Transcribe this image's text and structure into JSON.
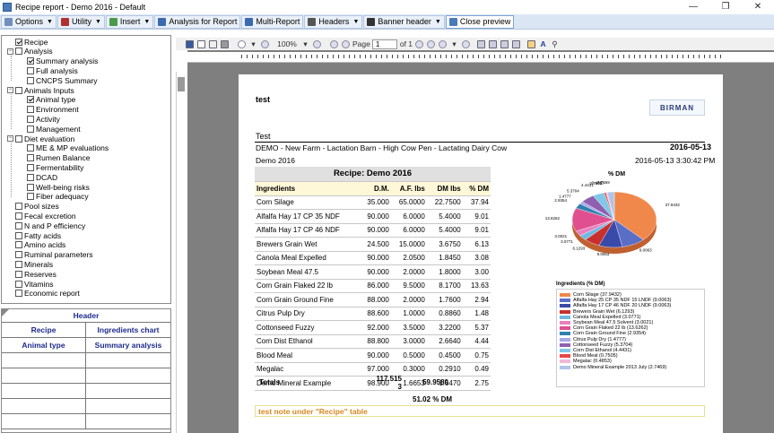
{
  "window": {
    "title": "Recipe report - Demo 2016 - Default"
  },
  "toolbar": [
    {
      "label": "Options",
      "dropdown": true,
      "icon": "gear-icon",
      "color": "#6f8fbf"
    },
    {
      "label": "Utility",
      "dropdown": true,
      "icon": "utility-icon",
      "color": "#b03030"
    },
    {
      "label": "Insert",
      "dropdown": true,
      "icon": "insert-icon",
      "color": "#4a9a4a"
    },
    {
      "label": "Analysis for Report",
      "dropdown": false,
      "icon": "analysis-icon",
      "color": "#3a6ab0"
    },
    {
      "label": "Multi-Report",
      "dropdown": false,
      "icon": "multi-report-icon",
      "color": "#3a6ab0"
    },
    {
      "label": "Headers",
      "dropdown": true,
      "icon": "headers-icon",
      "color": "#555555"
    },
    {
      "label": "Banner header",
      "dropdown": true,
      "icon": "banner-header-icon",
      "color": "#333333"
    },
    {
      "label": "Close preview",
      "dropdown": false,
      "icon": "close-preview-icon",
      "color": "#4a7ab8"
    }
  ],
  "tree": [
    {
      "label": "Recipe",
      "level": 0,
      "checked": true,
      "expander": false
    },
    {
      "label": "Analysis",
      "level": 0,
      "checked": false,
      "expander": true
    },
    {
      "label": "Summary analysis",
      "level": 1,
      "checked": true
    },
    {
      "label": "Full analysis",
      "level": 1,
      "checked": false
    },
    {
      "label": "CNCPS Summary",
      "level": 1,
      "checked": false
    },
    {
      "label": "Animals Inputs",
      "level": 0,
      "checked": false,
      "expander": true
    },
    {
      "label": "Animal type",
      "level": 1,
      "checked": true
    },
    {
      "label": "Environment",
      "level": 1,
      "checked": false
    },
    {
      "label": "Activity",
      "level": 1,
      "checked": false
    },
    {
      "label": "Management",
      "level": 1,
      "checked": false
    },
    {
      "label": "Diet evaluation",
      "level": 0,
      "checked": false,
      "expander": true
    },
    {
      "label": "ME & MP evaluations",
      "level": 1,
      "checked": false
    },
    {
      "label": "Rumen Balance",
      "level": 1,
      "checked": false
    },
    {
      "label": "Fermentability",
      "level": 1,
      "checked": false
    },
    {
      "label": "DCAD",
      "level": 1,
      "checked": false
    },
    {
      "label": "Well-being risks",
      "level": 1,
      "checked": false
    },
    {
      "label": "Fiber adequacy",
      "level": 1,
      "checked": false
    },
    {
      "label": "Pool sizes",
      "level": 0,
      "checked": false
    },
    {
      "label": "Fecal excretion",
      "level": 0,
      "checked": false
    },
    {
      "label": "N and P efficiency",
      "level": 0,
      "checked": false
    },
    {
      "label": "Fatty acids",
      "level": 0,
      "checked": false
    },
    {
      "label": "Amino acids",
      "level": 0,
      "checked": false
    },
    {
      "label": "Ruminal parameters",
      "level": 0,
      "checked": false
    },
    {
      "label": "Minerals",
      "level": 0,
      "checked": false
    },
    {
      "label": "Reserves",
      "level": 0,
      "checked": false
    },
    {
      "label": "Vitamins",
      "level": 0,
      "checked": false
    },
    {
      "label": "Economic report",
      "level": 0,
      "checked": false
    }
  ],
  "header_grid": {
    "title": "Header",
    "rows": [
      [
        "Recipe",
        "Ingredients chart"
      ],
      [
        "Animal type",
        "Summary analysis"
      ]
    ]
  },
  "viewer": {
    "zoom": "100%",
    "page_label": "Page",
    "page": "1",
    "of_label": "of 1"
  },
  "report": {
    "heading": "test",
    "logo_text": "BIRMAN",
    "subtitle": "Test",
    "farm_line": "DEMO - New Farm - Lactation Barn - High Cow Pen - Lactating Dairy Cow",
    "date": "2016-05-13",
    "recipe_name": "Demo 2016",
    "timestamp": "2016-05-13 3:30:42 PM",
    "table_title": "Recipe: Demo 2016",
    "columns": [
      "Ingredients",
      "D.M.",
      "A.F. lbs",
      "DM lbs",
      "% DM"
    ],
    "rows": [
      [
        "Corn Silage",
        "35.000",
        "65.0000",
        "22.7500",
        "37.94"
      ],
      [
        "Alfalfa Hay 17 CP 35 NDF",
        "90.000",
        "6.0000",
        "5.4000",
        "9.01"
      ],
      [
        "Alfalfa Hay 17 CP 46 NDF",
        "90.000",
        "6.0000",
        "5.4000",
        "9.01"
      ],
      [
        "Brewers Grain Wet",
        "24.500",
        "15.0000",
        "3.6750",
        "6.13"
      ],
      [
        "Canola Meal Expelled",
        "90.000",
        "2.0500",
        "1.8450",
        "3.08"
      ],
      [
        "Soybean Meal 47.5",
        "90.000",
        "2.0000",
        "1.8000",
        "3.00"
      ],
      [
        "Corn Grain Flaked 22 lb",
        "86.000",
        "9.5000",
        "8.1700",
        "13.63"
      ],
      [
        "Corn Grain Ground Fine",
        "88.000",
        "2.0000",
        "1.7600",
        "2.94"
      ],
      [
        "Citrus Pulp Dry",
        "88.600",
        "1.0000",
        "0.8860",
        "1.48"
      ],
      [
        "Cottonseed Fuzzy",
        "92.000",
        "3.5000",
        "3.2200",
        "5.37"
      ],
      [
        "Corn Dist Ethanol",
        "88.800",
        "3.0000",
        "2.6640",
        "4.44"
      ],
      [
        "Blood Meal",
        "90.000",
        "0.5000",
        "0.4500",
        "0.75"
      ],
      [
        "Megalac",
        "97.000",
        "0.3000",
        "0.2910",
        "0.49"
      ],
      [
        "Demo Mineral Example",
        "98.900",
        "1.6653",
        "1.6470",
        "2.75"
      ]
    ],
    "totals_label": "Totals",
    "totals_af_line1": "117.515",
    "totals_af_line2": "3",
    "totals_dm": "59.9580",
    "dm_percent": "51.02 % DM",
    "note": "test note under \"Recipe\" table"
  },
  "chart_data": {
    "type": "pie",
    "title": "% DM",
    "legend_title": "Ingredients (% DM)",
    "legend_placement": "bottom",
    "slices": [
      {
        "label": "Corn Silage (37.9432)",
        "value": 37.9432,
        "color": "#f0884c"
      },
      {
        "label": "Alfalfa Hay 25 CP 35 NDF 15 LNDF (9.0063)",
        "value": 9.0063,
        "color": "#5a6ec8"
      },
      {
        "label": "Alfalfa Hay 17 CP 46 NDF 20 LNDF (9.0063)",
        "value": 9.0063,
        "color": "#3a4aa8"
      },
      {
        "label": "Brewers Grain Wet (6.1293)",
        "value": 6.1293,
        "color": "#c83030"
      },
      {
        "label": "Canola Meal Expelled (3.0771)",
        "value": 3.0771,
        "color": "#70b8e0"
      },
      {
        "label": "Soybean Meal 47.5 Solvent (3.0021)",
        "value": 3.0021,
        "color": "#e880c0"
      },
      {
        "label": "Corn Grain Flaked 22 lb (13.6262)",
        "value": 13.6262,
        "color": "#e05090"
      },
      {
        "label": "Corn Grain Ground Fine (2.9354)",
        "value": 2.9354,
        "color": "#3080b0"
      },
      {
        "label": "Citrus Pulp Dry (1.4777)",
        "value": 1.4777,
        "color": "#a8a8e8"
      },
      {
        "label": "Cottonseed Fuzzy (5.3704)",
        "value": 5.3704,
        "color": "#9060b0"
      },
      {
        "label": "Corn Dist Ethanol (4.4431)",
        "value": 4.4431,
        "color": "#80c8e8"
      },
      {
        "label": "Blood Meal (0.7505)",
        "value": 0.7505,
        "color": "#e84848"
      },
      {
        "label": "Megalac (0.4853)",
        "value": 0.4853,
        "color": "#f0b8d8"
      },
      {
        "label": "Demo Mineral Example 2013 July (2.7469)",
        "value": 2.7469,
        "color": "#b0c4e8"
      }
    ],
    "slice_labels": [
      "37.9432",
      "9.0063",
      "9.0063",
      "6.1293",
      "3.0771",
      "3.0021",
      "13.6262",
      "2.9354",
      "1.4777",
      "5.3704",
      "4.4431",
      "0.7505",
      "0.4853",
      "2.7469"
    ]
  }
}
